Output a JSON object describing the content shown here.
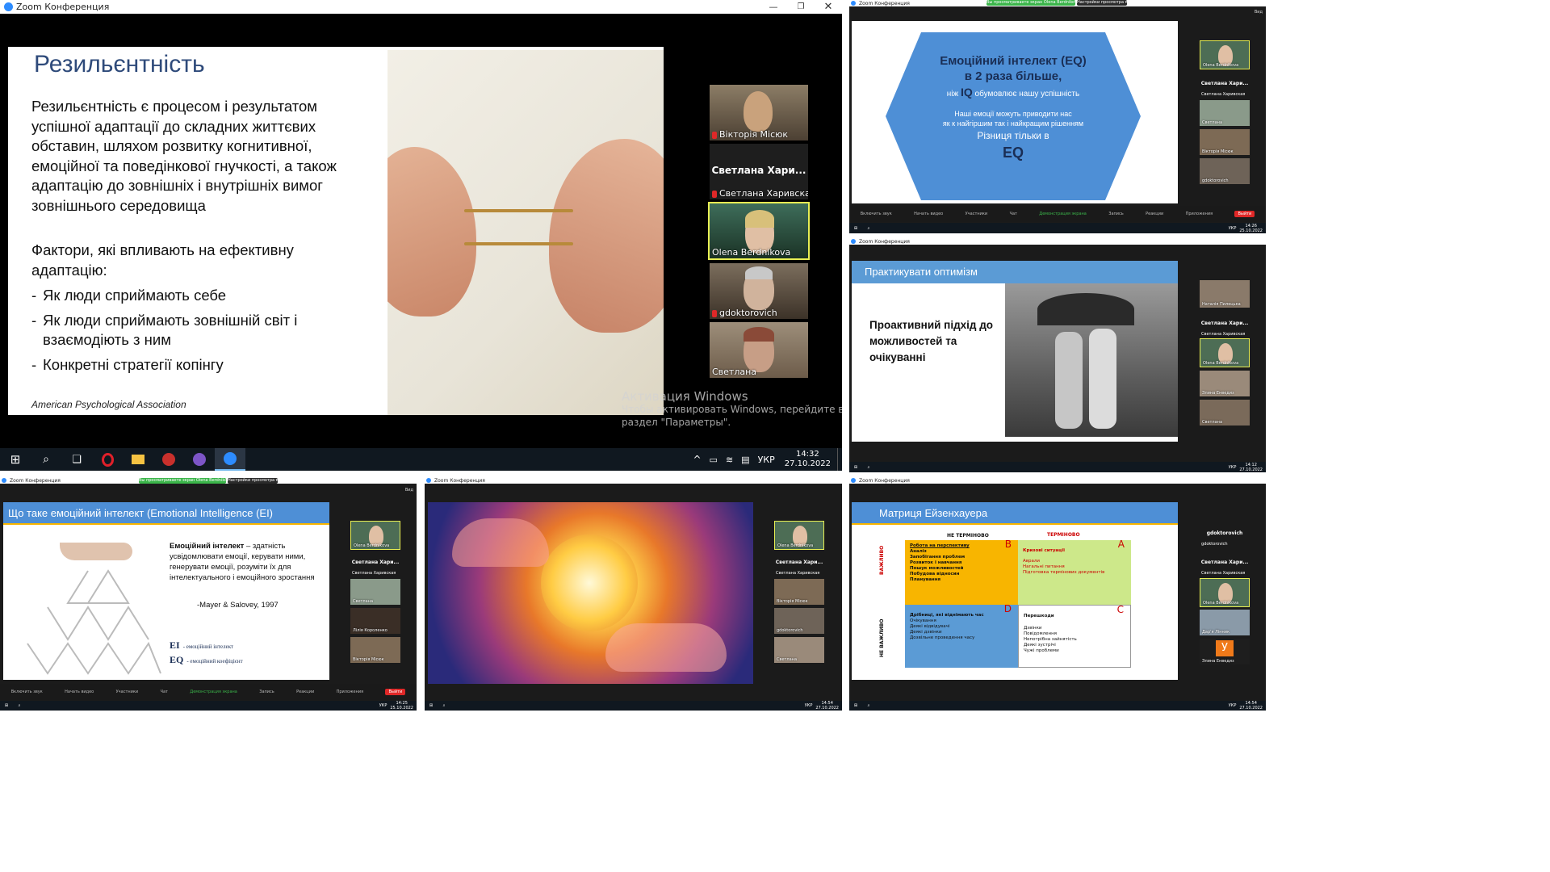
{
  "main": {
    "window_title": "Zoom Конференция",
    "slide": {
      "title": "Резильєнтність",
      "paragraph": "Резильєнтність є процесом і результатом успішної адаптації до складних  життєвих обставин, шляхом розвитку когнитивної, емоційної та поведінкової гнучкості, а також адаптацію до зовнішніх і внутрішніх вимог зовнішнього середовища",
      "factors_heading": "Фактори, які впливають на ефективну адаптацію:",
      "bullets": [
        "Як люди сприймають себе",
        "Як люди сприймають зовнішній світ і взаємодіють з ним",
        "Конкретні стратегії копінгу"
      ],
      "source": "American Psychological Association"
    },
    "participants": [
      {
        "name": "Вікторія Місюк",
        "muted": true
      },
      {
        "name": "Светлана Харивская",
        "display": "Светлана  Хари...",
        "muted": true
      },
      {
        "name": "Olena Berdnikova",
        "muted": false
      },
      {
        "name": "gdoktorovich",
        "muted": true
      },
      {
        "name": "Светлана",
        "muted": false
      }
    ],
    "activation": {
      "line1": "Активация Windows",
      "line2": "Чтобы активировать Windows, перейдите в",
      "line3": "раздел \"Параметры\"."
    },
    "taskbar": {
      "time": "14:32",
      "date": "27.10.2022",
      "lang": "УКР"
    }
  },
  "eq_window": {
    "window_title": "Zoom Конференция",
    "banner_green": "Вы просматриваете экран Olena Berdnikova",
    "banner_dark": "Настройки просмотра ▾",
    "view_label": "Вид",
    "hex": {
      "line1": "Емоційний інтелект (EQ)",
      "line2": "в 2 раза більше,",
      "line3_pre": "ніж",
      "line3_iq": "IQ",
      "line3_post": "обумовлює нашу успішність",
      "line4": "Наші емоції можуть приводити нас",
      "line5": "як к найгіршим так і найкращим рішенням",
      "line6": "Різниця тільки в",
      "line7": "EQ"
    },
    "participants": [
      "Olena Berdnikova",
      "Светлана  Хари...",
      "Светлана Харивская",
      "Светлана",
      "Вікторія Місюк",
      "gdoktorovich"
    ],
    "toolbar": [
      "Включить звук",
      "Начать видео",
      "Участники",
      "Чат",
      "Демонстрация экрана",
      "Запись",
      "Реакции",
      "Приложения"
    ],
    "participants_count": "16",
    "exit": "Выйти",
    "taskbar": {
      "time": "14:26",
      "date": "25.10.2022",
      "lang": "УКР"
    }
  },
  "opt_window": {
    "window_title": "Zoom Конференция",
    "slide_title": "Практикувати оптимізм",
    "body": "Проактивний підхід до можливостей та очікуванні",
    "participants": [
      "Наталія Пилецька",
      "Светлана  Хари...",
      "Светлана Харивская",
      "Olena Berdnikova",
      "Элина Енведиз",
      "Светлана"
    ],
    "taskbar": {
      "time": "14:12",
      "date": "27.10.2022",
      "lang": "УКР"
    }
  },
  "ei_window": {
    "window_title": "Zoom Конференция",
    "banner_green": "Вы просматриваете экран Olena Berdnikova",
    "banner_dark": "Настройки просмотра ▾",
    "view_label": "Вид",
    "slide_title": "Що таке емоційний інтелект (Emotional Intelligence (EI)",
    "definition_bold": "Емоційний інтелект",
    "definition_rest": " – здатність усвідомлювати емоції, керувати ними, генерувати емоції, розуміти їх для інтелектуального і емоційного зростання",
    "citation": "-Mayer & Salovey, 1997",
    "ei_label": "EI",
    "ei_text": "- емоційний інтелект",
    "eq_label": "EQ",
    "eq_text": "- емоційний коефіцієнт",
    "participants": [
      "Olena Berdnikova",
      "Светлана  Хари...",
      "Светлана Харивская",
      "Светлана",
      "Лілія Короленко",
      "Вікторія Місюк"
    ],
    "toolbar": [
      "Включить звук",
      "Начать видео",
      "Участники",
      "Чат",
      "Демонстрация экрана",
      "Запись",
      "Реакции",
      "Приложения"
    ],
    "participants_count": "17",
    "exit": "Выйти",
    "taskbar": {
      "time": "14:25",
      "date": "25.10.2022",
      "lang": "УКР"
    }
  },
  "sun_window": {
    "window_title": "Zoom Конференция",
    "participants": [
      "Olena Berdnikova",
      "Светлана  Хари...",
      "Светлана Харивская",
      "Вікторія Місюк",
      "gdoktorovich",
      "Светлана"
    ],
    "taskbar": {
      "time": "14:54",
      "date": "27.10.2022",
      "lang": "УКР"
    }
  },
  "eis_window": {
    "window_title": "Zoom Конференция",
    "slide_title": "Матриця Ейзенхауера",
    "col_not_urgent": "НЕ ТЕРМІНОВО",
    "col_urgent": "ТЕРМІНОВО",
    "row_important": "ВАЖЛИВО",
    "row_not_important": "НЕ ВАЖЛИВО",
    "quadrant_b": {
      "letter": "B",
      "head": "Робота на перспективу",
      "items": [
        "Аналіз",
        "Запобігання проблем",
        "Розвиток і навчання",
        "Пошук можливостей",
        "Побудова відносин",
        "Планування"
      ]
    },
    "quadrant_a": {
      "letter": "A",
      "head": "Кризові ситуації",
      "items": [
        "Аврали",
        "Нагальні питання",
        "Підготовка термінових документів"
      ]
    },
    "quadrant_d": {
      "letter": "D",
      "head": "Дрібниці, які віднімають час",
      "items": [
        "Очікування",
        "Деякі відвідувачі",
        "Деякі дзвінки",
        "Дозвільне проведення часу"
      ]
    },
    "quadrant_c": {
      "letter": "C",
      "head": "Перешкоди",
      "items": [
        "Дзвінки",
        "Повідомлення",
        "Непотрібна зайнятість",
        "Деякі зустрічі",
        "Чужі проблеми"
      ]
    },
    "participants": [
      "gdoktorovich",
      "gdoktorovich",
      "Светлана  Хари...",
      "Светлана Харивская",
      "Olena Berdnikova",
      "Дар'я Лінник",
      "Элина Енведиз"
    ],
    "avatar_letter": "У",
    "taskbar": {
      "time": "14:54",
      "date": "27.10.2022",
      "lang": "УКР"
    }
  },
  "colors": {
    "zoom_blue": "#2d8cff",
    "slide_blue": "#4e8fd6",
    "banner_green": "#3bb54a",
    "exit_red": "#e02828",
    "quad_orange": "#f8b500",
    "quad_green": "#cde88a",
    "quad_blue": "#5b9bd5"
  }
}
